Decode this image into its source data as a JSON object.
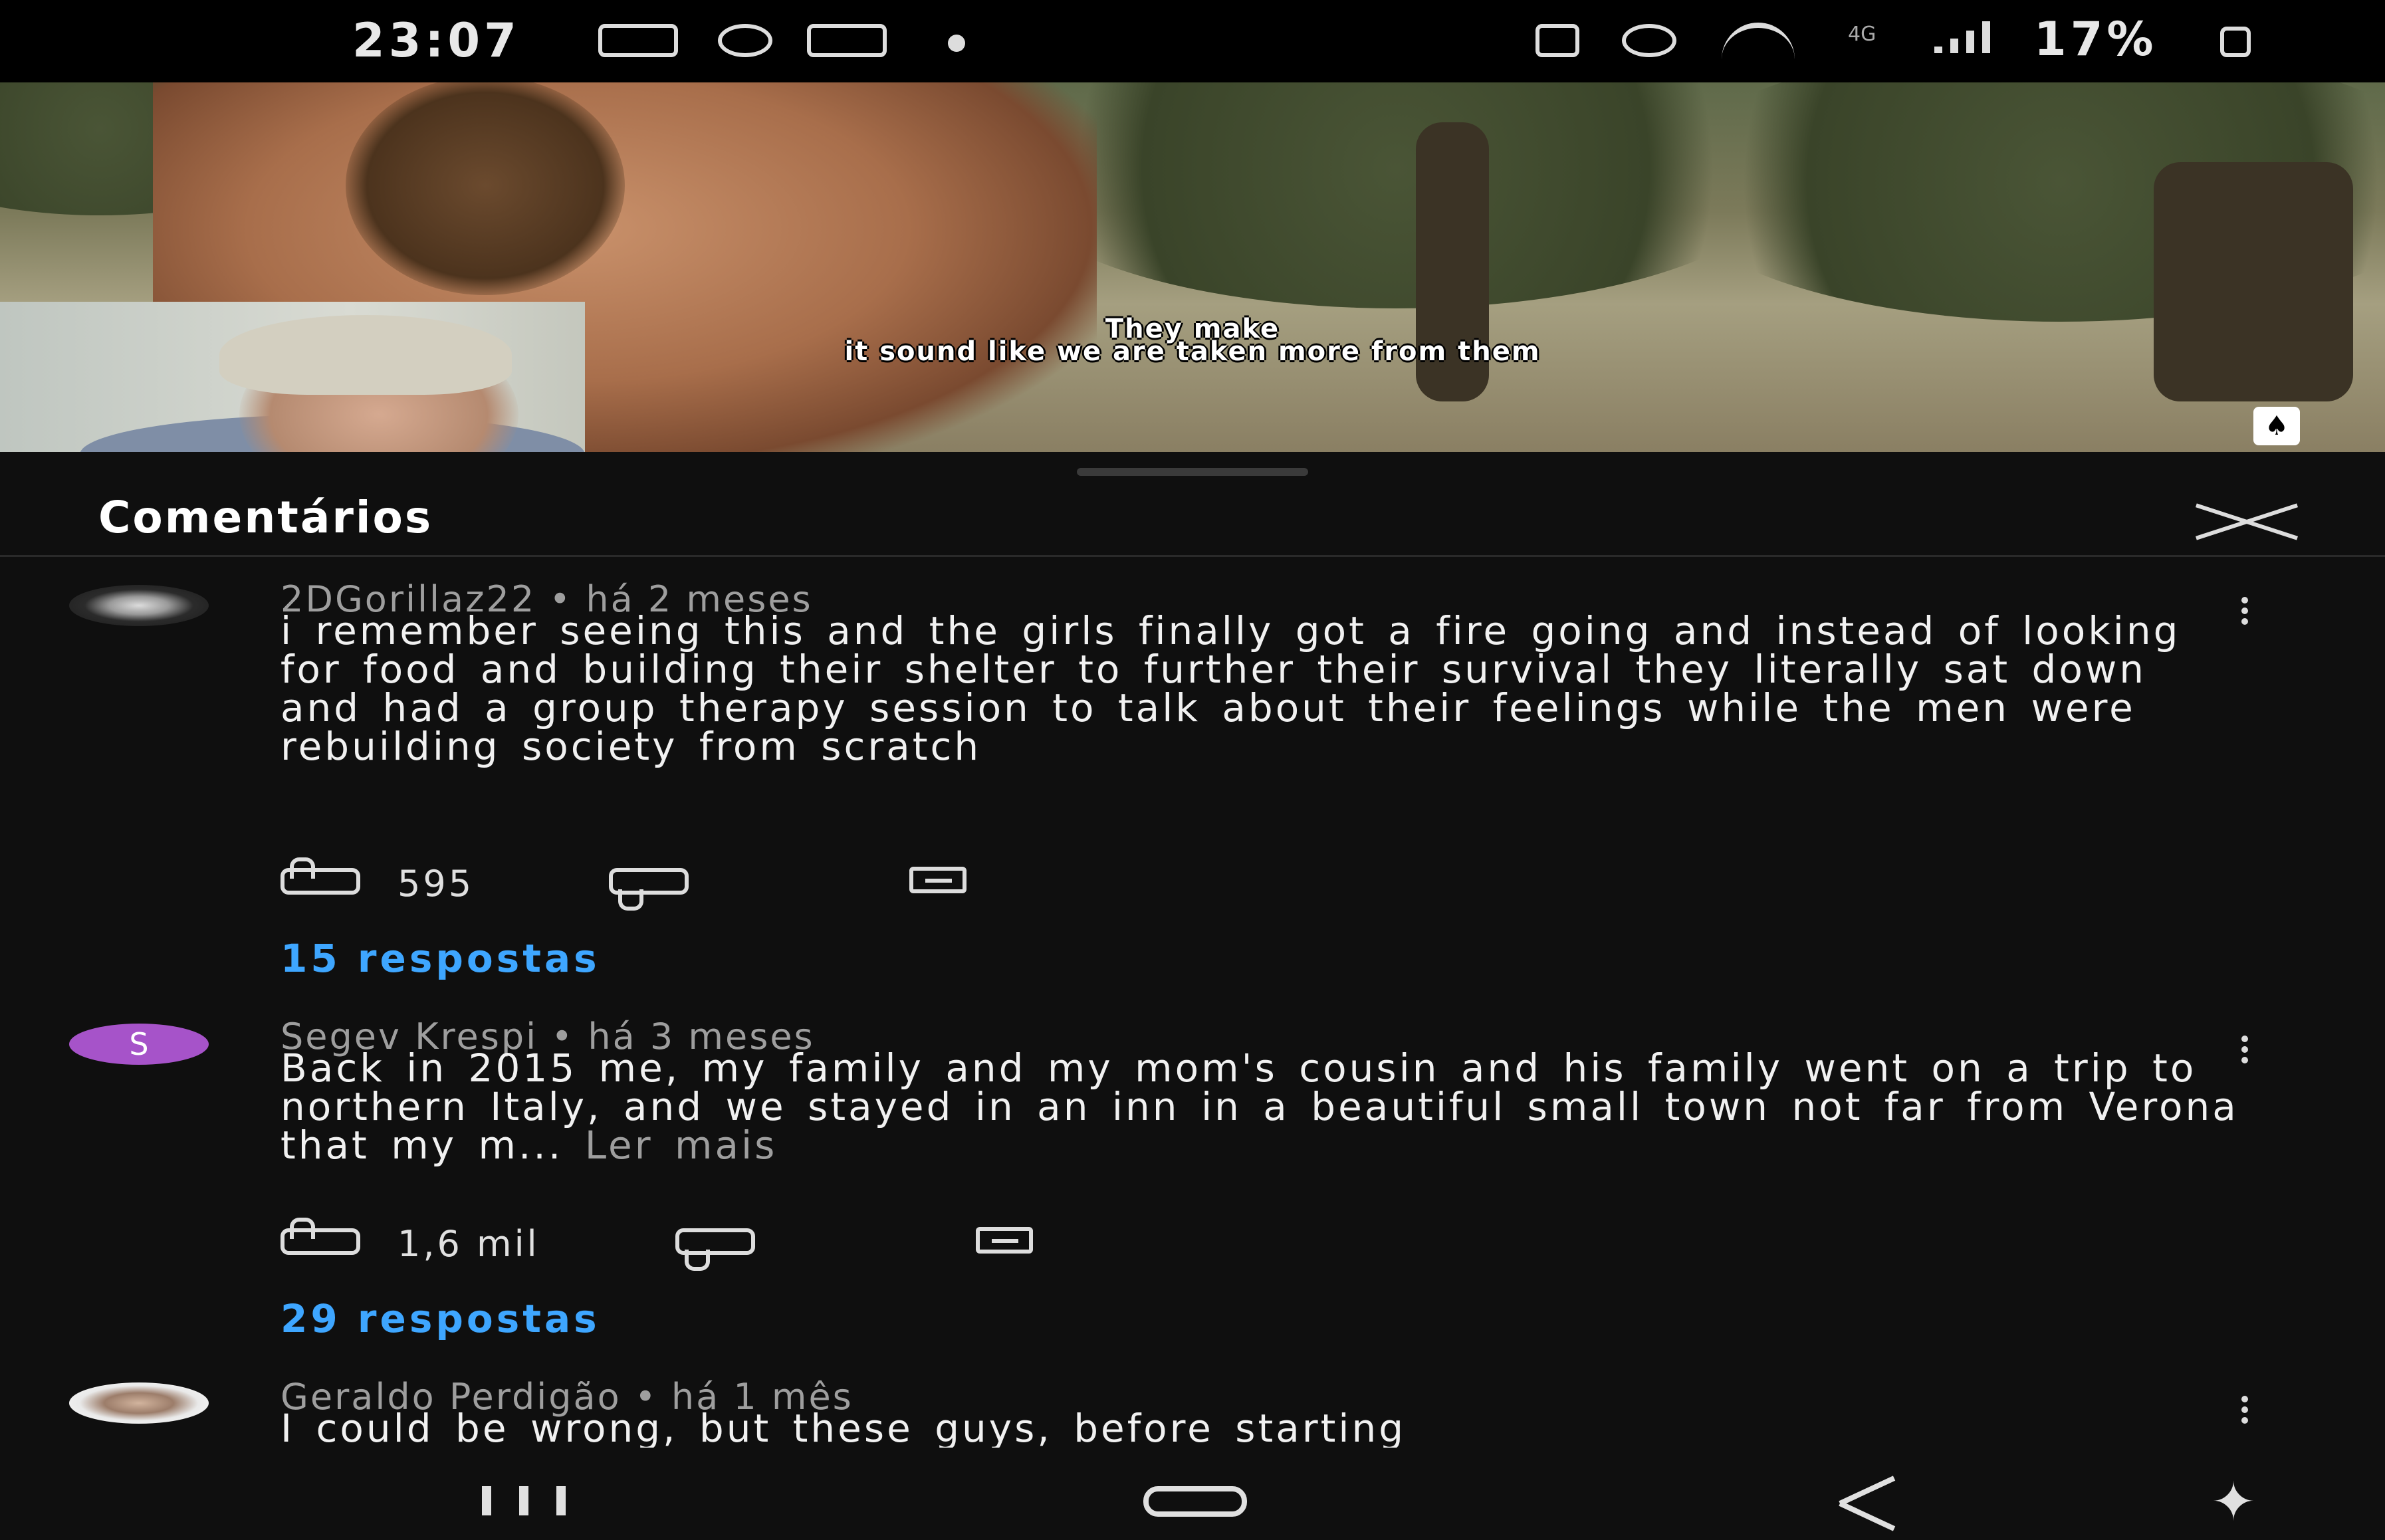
{
  "status_bar": {
    "time": "23:07",
    "battery_text": "17%",
    "network": "4G",
    "icons": [
      "keyboard-icon",
      "timer-icon",
      "notification-icon",
      "dot-icon",
      "alarm-icon",
      "wifi-icon",
      "signal-icon",
      "battery-icon"
    ]
  },
  "video": {
    "subtitle_line1": "They make",
    "subtitle_line2": "it sound like we are taken more from them"
  },
  "panel": {
    "title": "Comentários"
  },
  "comments": [
    {
      "author": "2DGorillaz22",
      "time": "há 2 meses",
      "text": "i remember seeing this and the girls finally got a fire going and instead of looking for food and building their shelter to further their survival they literally sat down and had a group therapy session to talk about their feelings while the men were rebuilding society from scratch",
      "likes": "595",
      "replies": "15 respostas"
    },
    {
      "author": "Segev Krespi",
      "avatar_letter": "S",
      "time": "há 3 meses",
      "text": "Back in 2015 me, my family and my mom's cousin and his family went on a trip to northern Italy, and we stayed in an inn in a beautiful small town not far from Verona that my m...",
      "read_more": "Ler mais",
      "likes": "1,6 mil",
      "replies": "29 respostas"
    },
    {
      "author": "Geraldo Perdigão",
      "time": "há 1 mês",
      "text": "I could be wrong, but these guys, before starting"
    }
  ],
  "colors": {
    "background": "#0f0f0f",
    "link_blue": "#3ea6ff",
    "avatar_purple": "#a653c9"
  }
}
